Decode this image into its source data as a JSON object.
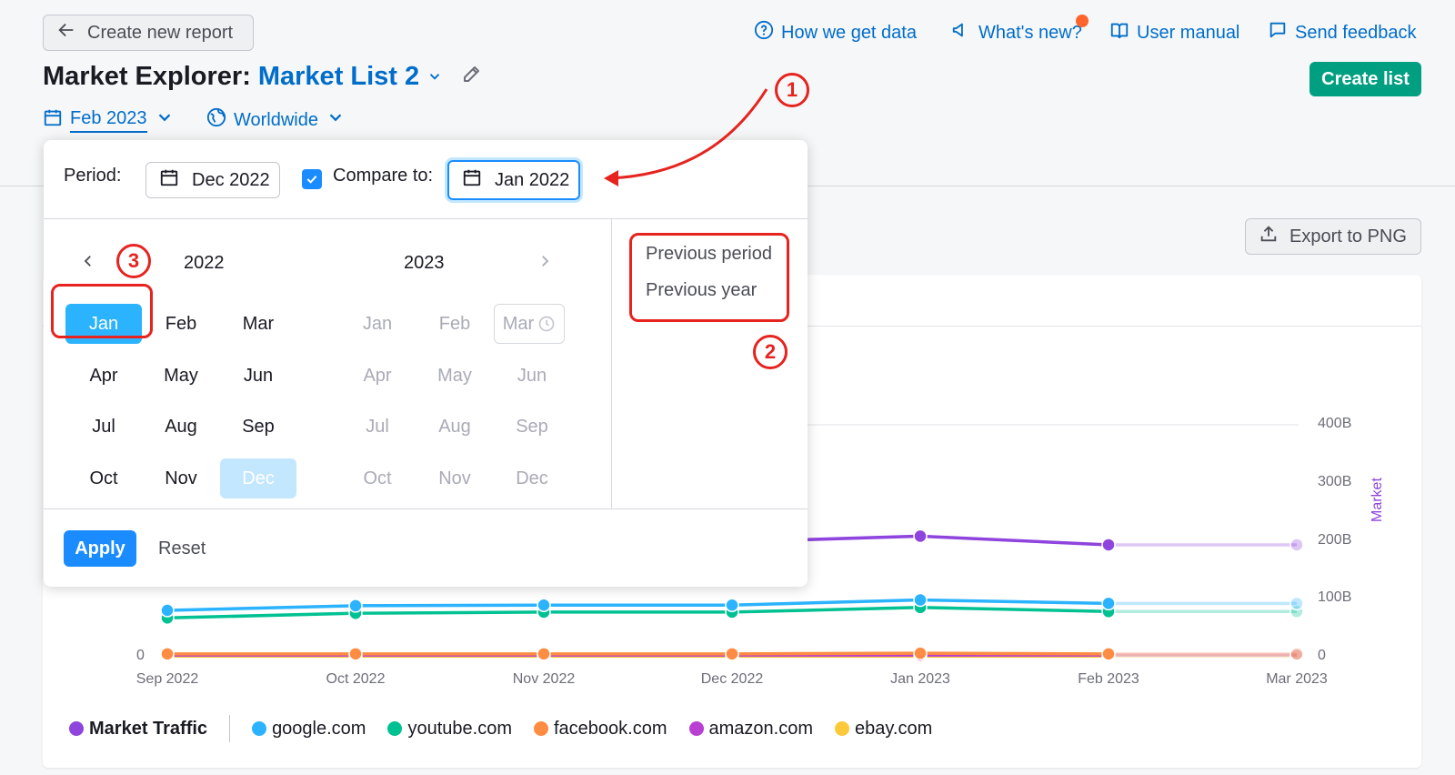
{
  "header": {
    "back_label": "Create new report",
    "how_we_get_data": "How we get data",
    "whats_new": "What's new?",
    "user_manual": "User manual",
    "send_feedback": "Send feedback",
    "title_prefix": "Market Explorer:",
    "list_name": "Market List 2",
    "create_list": "Create list"
  },
  "filters": {
    "date": "Feb 2023",
    "region": "Worldwide"
  },
  "toolbar": {
    "export": "Export to PNG"
  },
  "popup": {
    "period_label": "Period:",
    "period_value": "Dec 2022",
    "compare_label": "Compare to:",
    "compare_value": "Jan 2022",
    "compare_checked": true,
    "year_left": "2022",
    "year_right": "2023",
    "months_left": [
      "Jan",
      "Feb",
      "Mar",
      "Apr",
      "May",
      "Jun",
      "Jul",
      "Aug",
      "Sep",
      "Oct",
      "Nov",
      "Dec"
    ],
    "months_right": [
      "Jan",
      "Feb",
      "Mar",
      "Apr",
      "May",
      "Jun",
      "Jul",
      "Aug",
      "Sep",
      "Oct",
      "Nov",
      "Dec"
    ],
    "selected_compare": "Jan",
    "selected_period": "Dec",
    "presets": [
      "Previous period",
      "Previous year"
    ],
    "apply": "Apply",
    "reset": "Reset"
  },
  "annotations": [
    "1",
    "2",
    "3"
  ],
  "colors": {
    "accent": "#006dca",
    "create": "#009f81",
    "annotation": "#e6231e",
    "selected": "#2bb3ff",
    "selected_light": "#c3e7ff"
  },
  "chart_data": {
    "type": "line",
    "x": [
      "Sep 2022",
      "Oct 2022",
      "Nov 2022",
      "Dec 2022",
      "Jan 2023",
      "Feb 2023",
      "Mar 2023"
    ],
    "y_ticks": [
      "0",
      "100B",
      "200B",
      "300B",
      "400B"
    ],
    "ylabel": "Market",
    "ylim": [
      0,
      400
    ],
    "series": [
      {
        "name": "Market Traffic",
        "color": "#8e44dd",
        "values": [
          null,
          null,
          null,
          198,
          208,
          193,
          193
        ]
      },
      {
        "name": "google.com",
        "color": "#2bb3ff",
        "values": [
          80,
          88,
          89,
          89,
          98,
          92,
          92
        ]
      },
      {
        "name": "youtube.com",
        "color": "#00c192",
        "values": [
          67,
          75,
          77,
          77,
          85,
          78,
          78
        ]
      },
      {
        "name": "facebook.com",
        "color": "#ff8c43",
        "values": [
          5,
          5,
          5,
          5,
          6,
          5,
          5
        ]
      },
      {
        "name": "amazon.com",
        "color": "#b83fd2",
        "values": [
          3,
          3,
          3,
          3,
          3,
          3,
          3
        ]
      },
      {
        "name": "ebay.com",
        "color": "#fcc93a",
        "values": [
          1,
          1,
          1,
          1,
          1,
          1,
          1
        ]
      }
    ]
  }
}
